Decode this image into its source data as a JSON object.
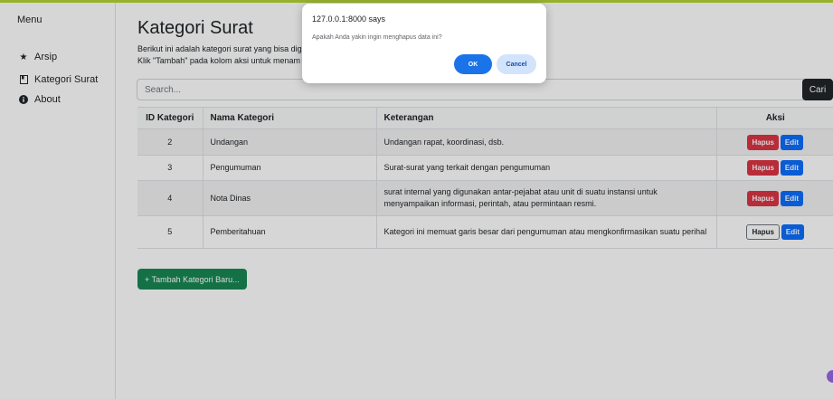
{
  "sidebar": {
    "title": "Menu",
    "items": [
      {
        "label": "Arsip",
        "icon": "star-icon"
      },
      {
        "label": "Kategori Surat",
        "icon": "bookmark-icon"
      },
      {
        "label": "About",
        "icon": "info-circle-icon"
      }
    ]
  },
  "main": {
    "title": "Kategori Surat",
    "description_line1": "Berikut ini adalah kategori surat yang bisa diguna",
    "description_line2": "Klik \"Tambah\" pada kolom aksi untuk menam"
  },
  "search": {
    "placeholder": "Search...",
    "button_label": "Cari"
  },
  "table": {
    "headers": [
      "ID Kategori",
      "Nama Kategori",
      "Keterangan",
      "Aksi"
    ],
    "rows": [
      {
        "id": "2",
        "name": "Undangan",
        "desc": "Undangan rapat, koordinasi, dsb.",
        "hapus": "Hapus",
        "edit": "Edit"
      },
      {
        "id": "3",
        "name": "Pengumuman",
        "desc": "Surat-surat yang terkait dengan pengumuman",
        "hapus": "Hapus",
        "edit": "Edit"
      },
      {
        "id": "4",
        "name": "Nota Dinas",
        "desc": "surat internal yang digunakan antar-pejabat atau unit di suatu instansi untuk menyampaikan informasi, perintah, atau permintaan resmi.",
        "hapus": "Hapus",
        "edit": "Edit"
      },
      {
        "id": "5",
        "name": "Pemberitahuan",
        "desc": "Kategori ini memuat garis besar dari pengumuman atau mengkonfirmasikan suatu perihal",
        "hapus": "Hapus",
        "edit": "Edit"
      }
    ]
  },
  "add_button": "+ Tambah Kategori Baru...",
  "dialog": {
    "title": "127.0.0.1:8000 says",
    "message": "Apakah Anda yakin ingin menghapus data ini?",
    "ok_label": "OK",
    "cancel_label": "Cancel"
  },
  "colors": {
    "danger": "#dc3545",
    "primary": "#0d6efd",
    "success": "#198754",
    "dialog_ok": "#1a73e8",
    "dialog_cancel": "#d2e3fc"
  }
}
